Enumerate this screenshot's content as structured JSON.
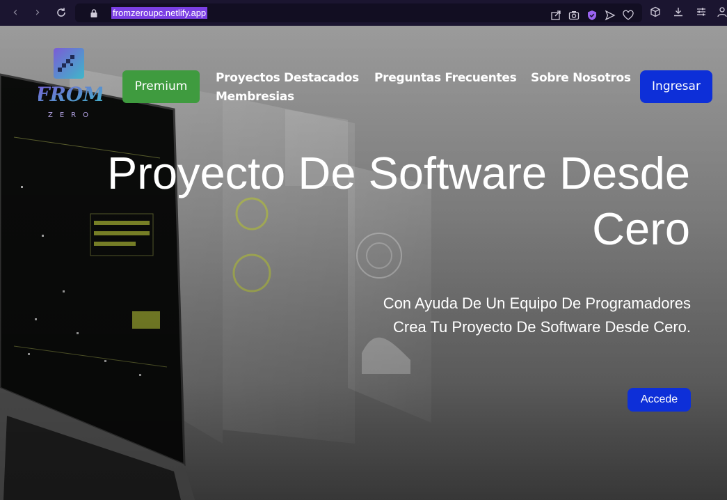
{
  "browser": {
    "url": "fromzeroupc.netlify.app",
    "back_icon": "chevron-left-icon",
    "forward_icon": "chevron-right-icon",
    "reload_icon": "reload-icon",
    "accent": "#7b3fe4"
  },
  "header": {
    "logo_text": "FROM",
    "logo_subtext": "ZERO",
    "premium_label": "Premium",
    "nav": [
      "Proyectos Destacados",
      "Membresias",
      "Preguntas Frecuentes",
      "Sobre Nosotros"
    ],
    "login_label": "Ingresar"
  },
  "hero": {
    "title_line1": "Proyecto De Software Desde",
    "title_line2": "Cero",
    "subtitle_line1": "Con Ayuda De Un Equipo De Programadores",
    "subtitle_line2": "Crea Tu Proyecto De Software Desde Cero.",
    "cta_label": "Accede"
  },
  "colors": {
    "premium": "#3f9b3f",
    "primary_button": "#0d2fd8",
    "browser_bg": "#1b1530"
  }
}
